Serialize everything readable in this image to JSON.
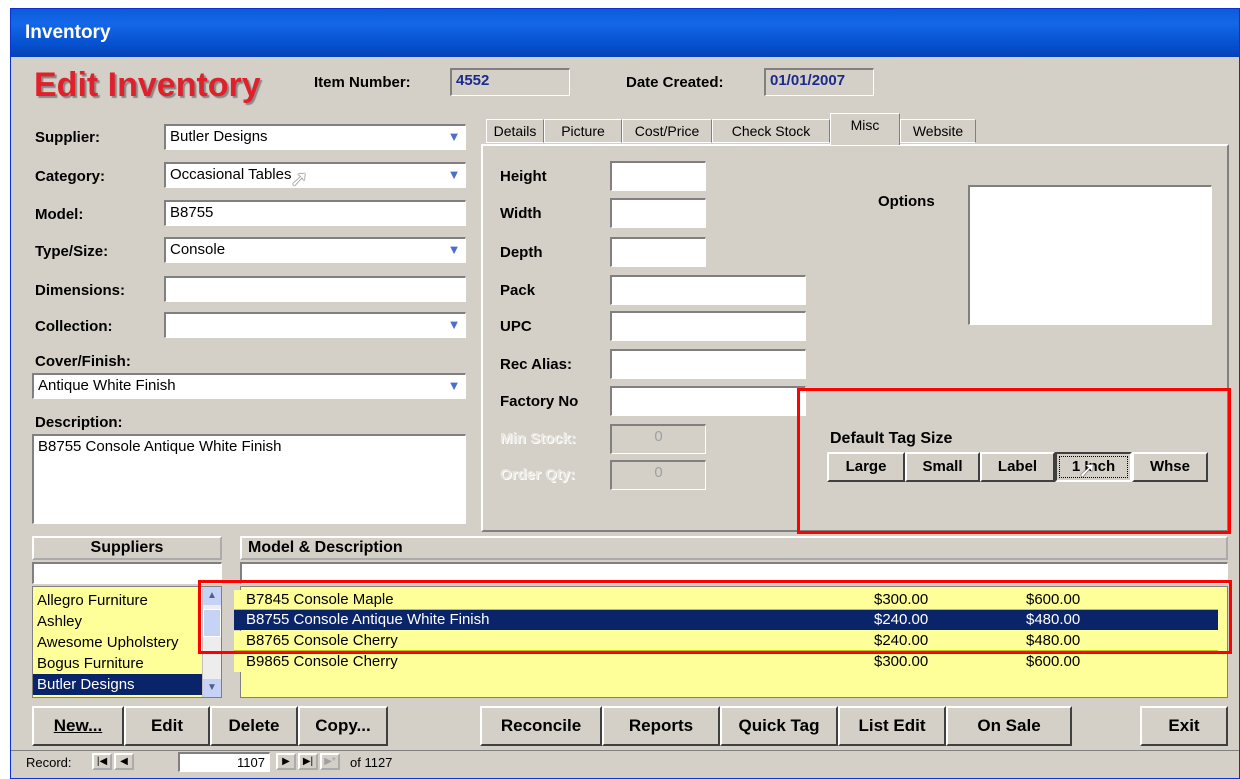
{
  "window": {
    "title": "Inventory"
  },
  "header": {
    "title": "Edit Inventory",
    "item_number_label": "Item Number:",
    "item_number": "4552",
    "date_created_label": "Date Created:",
    "date_created": "01/01/2007"
  },
  "fields": {
    "supplier_label": "Supplier:",
    "supplier": "Butler Designs",
    "category_label": "Category:",
    "category": "Occasional Tables",
    "model_label": "Model:",
    "model": "B8755",
    "type_label": "Type/Size:",
    "type": "Console",
    "dimensions_label": "Dimensions:",
    "dimensions": "",
    "collection_label": "Collection:",
    "collection": "",
    "cover_label": "Cover/Finish:",
    "cover": "Antique White Finish",
    "description_label": "Description:",
    "description": "B8755 Console Antique White Finish"
  },
  "tabs": [
    "Details",
    "Picture",
    "Cost/Price",
    "Check Stock",
    "Misc",
    "Website"
  ],
  "misc": {
    "height_label": "Height",
    "width_label": "Width",
    "depth_label": "Depth",
    "pack_label": "Pack",
    "upc_label": "UPC",
    "rec_alias_label": "Rec Alias:",
    "factory_no_label": "Factory No",
    "min_stock_label": "Min Stock:",
    "min_stock": "0",
    "order_qty_label": "Order Qty:",
    "order_qty": "0",
    "options_label": "Options",
    "tag_size_label": "Default Tag Size",
    "tag_buttons": [
      "Large",
      "Small",
      "Label",
      "1 Inch",
      "Whse"
    ]
  },
  "suppliers": {
    "header": "Suppliers",
    "search": "",
    "items": [
      "Allegro Furniture",
      "Ashley",
      "Awesome Upholstery",
      "Bogus Furniture",
      "Butler Designs"
    ],
    "selected": "Butler Designs"
  },
  "models": {
    "header": "Model & Description",
    "search": "",
    "rows": [
      {
        "desc": "B7845 Console Maple",
        "cost": "$300.00",
        "price": "$600.00"
      },
      {
        "desc": "B8755 Console Antique White Finish",
        "cost": "$240.00",
        "price": "$480.00"
      },
      {
        "desc": "B8765 Console Cherry",
        "cost": "$240.00",
        "price": "$480.00"
      },
      {
        "desc": "B9865 Console Cherry",
        "cost": "$300.00",
        "price": "$600.00"
      }
    ]
  },
  "toolbar": {
    "new": "New...",
    "edit": "Edit",
    "delete": "Delete",
    "copy": "Copy...",
    "reconcile": "Reconcile",
    "reports": "Reports",
    "quick_tag": "Quick Tag",
    "list_edit": "List Edit",
    "on_sale": "On Sale",
    "exit": "Exit"
  },
  "record_nav": {
    "label": "Record:",
    "current": "1107",
    "of_text": "of 1127"
  },
  "colors": {
    "title_bar": "#0a5cd8",
    "header_red": "#e0202a",
    "list_yellow": "#ffff99",
    "selection": "#0a246a",
    "highlight": "#ff0000"
  }
}
